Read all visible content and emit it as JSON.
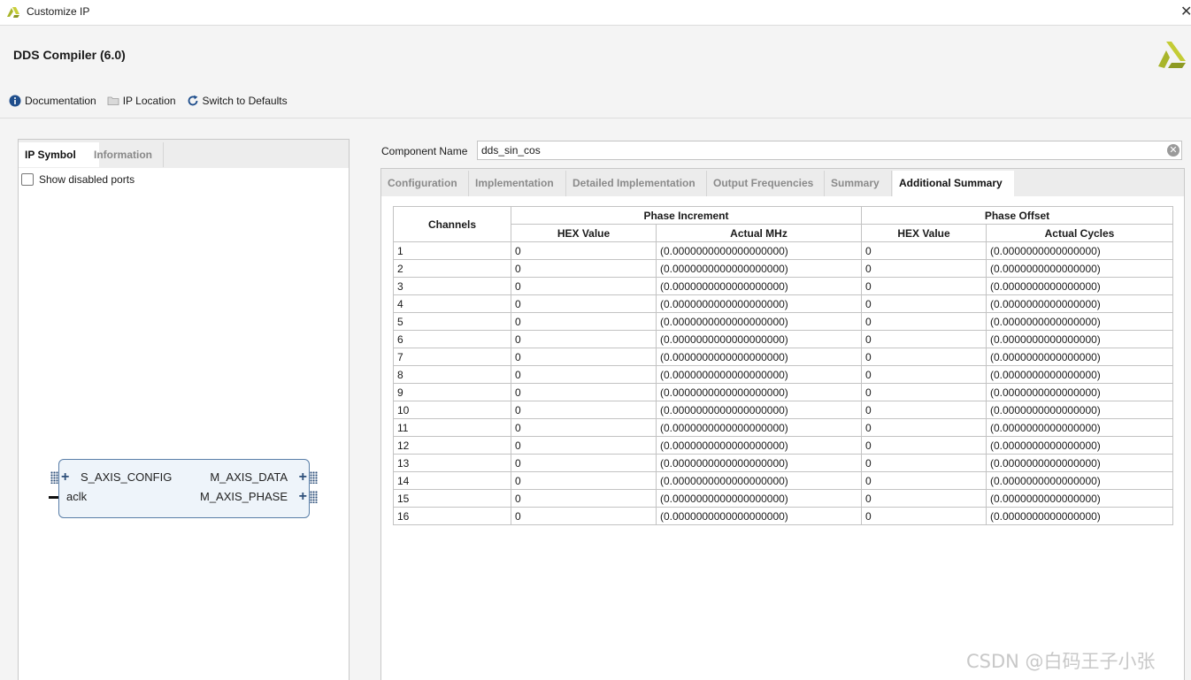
{
  "window": {
    "title": "Customize IP",
    "close_glyph": "✕"
  },
  "header": {
    "ip_name": "DDS Compiler (6.0)"
  },
  "toolbar": {
    "items": [
      {
        "label": "Documentation",
        "icon": "info-icon"
      },
      {
        "label": "IP Location",
        "icon": "folder-icon"
      },
      {
        "label": "Switch to Defaults",
        "icon": "refresh-icon"
      }
    ]
  },
  "left_panel": {
    "tabs": [
      "IP Symbol",
      "Information"
    ],
    "active_tab": "IP Symbol",
    "show_disabled_ports_label": "Show disabled ports",
    "show_disabled_ports_checked": false,
    "symbol": {
      "left_ports": [
        "S_AXIS_CONFIG",
        "aclk"
      ],
      "right_ports": [
        "M_AXIS_DATA",
        "M_AXIS_PHASE"
      ]
    }
  },
  "component": {
    "label": "Component Name",
    "value": "dds_sin_cos"
  },
  "right_tabs": {
    "items": [
      "Configuration",
      "Implementation",
      "Detailed Implementation",
      "Output Frequencies",
      "Summary",
      "Additional Summary"
    ],
    "active": "Additional Summary"
  },
  "table": {
    "channels_header": "Channels",
    "group_headers": [
      "Phase Increment",
      "Phase Offset"
    ],
    "sub_headers": [
      "HEX Value",
      "Actual MHz",
      "HEX Value",
      "Actual Cycles"
    ],
    "rows": [
      [
        "1",
        "0",
        "(0.0000000000000000000)",
        "0",
        "(0.0000000000000000)"
      ],
      [
        "2",
        "0",
        "(0.0000000000000000000)",
        "0",
        "(0.0000000000000000)"
      ],
      [
        "3",
        "0",
        "(0.0000000000000000000)",
        "0",
        "(0.0000000000000000)"
      ],
      [
        "4",
        "0",
        "(0.0000000000000000000)",
        "0",
        "(0.0000000000000000)"
      ],
      [
        "5",
        "0",
        "(0.0000000000000000000)",
        "0",
        "(0.0000000000000000)"
      ],
      [
        "6",
        "0",
        "(0.0000000000000000000)",
        "0",
        "(0.0000000000000000)"
      ],
      [
        "7",
        "0",
        "(0.0000000000000000000)",
        "0",
        "(0.0000000000000000)"
      ],
      [
        "8",
        "0",
        "(0.0000000000000000000)",
        "0",
        "(0.0000000000000000)"
      ],
      [
        "9",
        "0",
        "(0.0000000000000000000)",
        "0",
        "(0.0000000000000000)"
      ],
      [
        "10",
        "0",
        "(0.0000000000000000000)",
        "0",
        "(0.0000000000000000)"
      ],
      [
        "11",
        "0",
        "(0.0000000000000000000)",
        "0",
        "(0.0000000000000000)"
      ],
      [
        "12",
        "0",
        "(0.0000000000000000000)",
        "0",
        "(0.0000000000000000)"
      ],
      [
        "13",
        "0",
        "(0.0000000000000000000)",
        "0",
        "(0.0000000000000000)"
      ],
      [
        "14",
        "0",
        "(0.0000000000000000000)",
        "0",
        "(0.0000000000000000)"
      ],
      [
        "15",
        "0",
        "(0.0000000000000000000)",
        "0",
        "(0.0000000000000000)"
      ],
      [
        "16",
        "0",
        "(0.0000000000000000000)",
        "0",
        "(0.0000000000000000)"
      ]
    ]
  },
  "watermark": "CSDN @白码王子小张",
  "colors": {
    "accent": "#2d4f7a",
    "logo_green": "#a8b52a",
    "tab_inactive": "#8a8a8a"
  }
}
